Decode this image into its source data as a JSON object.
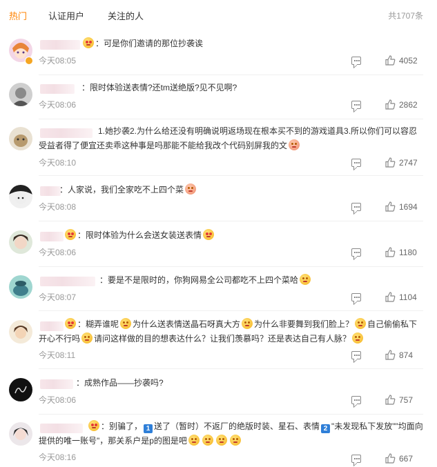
{
  "tabs": [
    {
      "label": "热门",
      "active": true
    },
    {
      "label": "认证用户",
      "active": false
    },
    {
      "label": "关注的人",
      "active": false
    }
  ],
  "total": "共1707条",
  "accent_color": "#ff8200",
  "comments": [
    {
      "text": "：可是你们邀请的那位抄袭诶",
      "time": "今天08:05",
      "likes": "4052",
      "emoji": [
        "heart-eyes-emoji"
      ]
    },
    {
      "text": "：限时体验送表情?还tm送绝版?见不见啊?",
      "time": "今天08:06",
      "likes": "2862",
      "emoji": []
    },
    {
      "text_a": "1.她抄袭2.为什么给还没有明确说明返场现在根本买不到的游戏道具3.所以你们可以容忍",
      "text_b": "受益者得了便宜还卖乖这种事是吗那能不能给我改个代码别屏我的文",
      "time": "今天08:10",
      "likes": "2747",
      "emoji": [
        "peach-emoji"
      ]
    },
    {
      "text": "：人家说，我们全家吃不上四个菜",
      "time": "今天08:08",
      "likes": "1694",
      "emoji": [
        "angry-emoji"
      ]
    },
    {
      "text": "：限时体验为什么会送女装送表情",
      "time": "今天08:06",
      "likes": "1180",
      "emoji": [
        "heart-eyes-emoji",
        "kiss-emoji"
      ]
    },
    {
      "text": "：要是不是限时的，你狗网易全公司都吃不上四个菜哈",
      "time": "今天08:07",
      "likes": "1104",
      "emoji": [
        "smile-emoji"
      ]
    },
    {
      "parts": [
        "：糊弄谁呢",
        "为什么送表情送晶石呀真大方",
        "为什么非要舞到我们脸上？",
        "自己偷偷私下"
      ],
      "text_b1": "开心不行吗",
      "text_b2": "请问这样做的目的想表达什么？让我们羡慕吗？还是表达自己有人脉？",
      "time": "今天08:11",
      "likes": "874",
      "emoji": [
        "heart-eyes-emoji",
        "wink-emoji"
      ]
    },
    {
      "text": "：成熟作品——抄袭吗?",
      "time": "今天08:06",
      "likes": "757",
      "emoji": []
    },
    {
      "parts": [
        "：别骗了，",
        "送了（暂时）不返厂的绝版时装、星石、表情",
        "\"未发现私下发放\"\"均面向"
      ],
      "badges": [
        "1",
        "2"
      ],
      "text_b": "提供的唯一账号\"，那关系户是p的图是吧",
      "time": "今天08:16",
      "likes": "667",
      "emoji": [
        "heart-eyes-emoji",
        "scream-emoji"
      ]
    }
  ]
}
